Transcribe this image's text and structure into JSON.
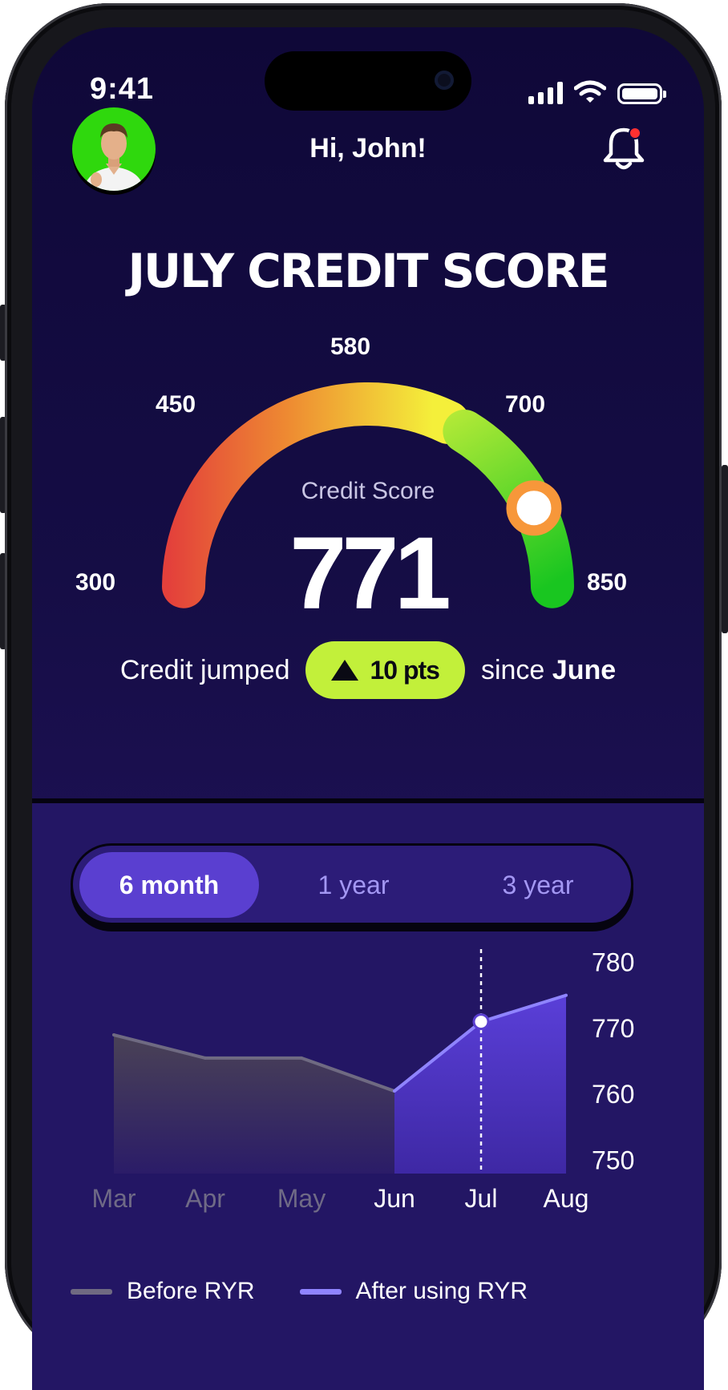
{
  "status_bar": {
    "time": "9:41"
  },
  "header": {
    "greeting": "Hi, John!"
  },
  "score": {
    "title": "JULY CREDIT SCORE",
    "label": "Credit Score",
    "value": "771",
    "numeric_value": 771,
    "range_min": 300,
    "range_max": 850,
    "ticks": {
      "min": "300",
      "low": "450",
      "mid": "580",
      "high": "700",
      "max": "850"
    }
  },
  "change": {
    "prefix": "Credit jumped",
    "amount": "10 pts",
    "suffix": "since",
    "month": "June"
  },
  "period_tabs": [
    {
      "label": "6 month",
      "active": true
    },
    {
      "label": "1 year",
      "active": false
    },
    {
      "label": "3 year",
      "active": false
    }
  ],
  "colors": {
    "accent": "#5a3fd0",
    "badge": "#c2f03a",
    "before_line": "#6f6a82",
    "after_line": "#8f84ff",
    "notification_dot": "#ff3030"
  },
  "chart_data": {
    "type": "area",
    "categories": [
      "Mar",
      "Apr",
      "May",
      "Jun",
      "Jul",
      "Aug"
    ],
    "ylim": [
      748,
      782
    ],
    "yticks": [
      "780",
      "770",
      "760",
      "750"
    ],
    "series": [
      {
        "name": "Before RYR",
        "values": [
          769,
          765.5,
          765.5,
          760.5,
          null,
          null
        ]
      },
      {
        "name": "After using RYR",
        "values": [
          null,
          null,
          null,
          760.5,
          771,
          775
        ]
      }
    ],
    "highlight": {
      "category": "Jul",
      "value": 771
    }
  }
}
